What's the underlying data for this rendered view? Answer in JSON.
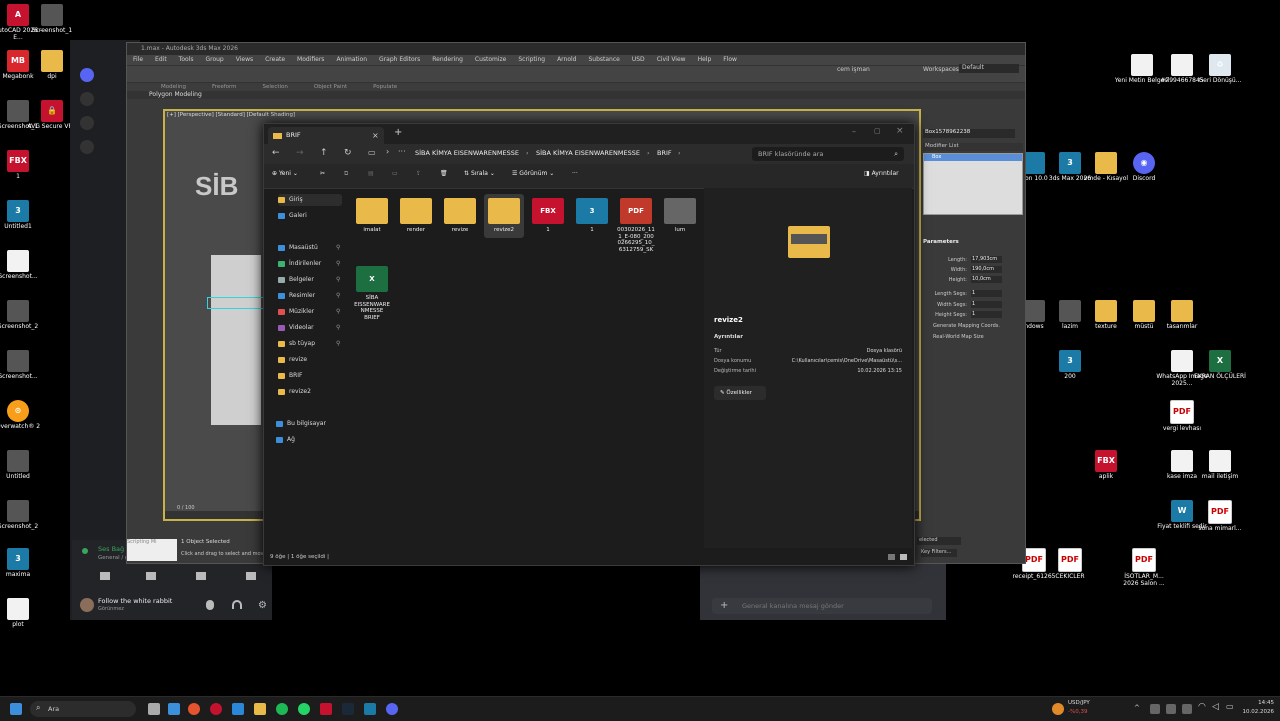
{
  "desktop_left": [
    {
      "label": "AutoCAD 2026 - E...",
      "icon": "A",
      "kind": "autocad"
    },
    {
      "label": "Screenshot_1",
      "icon": "",
      "kind": "gray"
    },
    {
      "label": "Megabonk",
      "icon": "MB",
      "kind": "mega"
    },
    {
      "label": "dpi",
      "icon": "",
      "kind": "folder"
    },
    {
      "label": "Screenshot_1",
      "icon": "",
      "kind": "gray"
    },
    {
      "label": "AVG Secure VPN",
      "icon": "🔒",
      "kind": "autocad"
    },
    {
      "label": "1",
      "icon": "FBX",
      "kind": "fbx"
    },
    {
      "label": "Untitled1",
      "icon": "3",
      "kind": "max"
    },
    {
      "label": "Screenshot...",
      "icon": "",
      "kind": "doc"
    },
    {
      "label": "Screenshot_2",
      "icon": "",
      "kind": "gray"
    },
    {
      "label": "Screenshot...",
      "icon": "",
      "kind": "gray"
    },
    {
      "label": "Overwatch® 2",
      "icon": "⊙",
      "kind": "ow"
    },
    {
      "label": "Untitled",
      "icon": "",
      "kind": "gray"
    },
    {
      "label": "Screenshot_2",
      "icon": "",
      "kind": "gray"
    },
    {
      "label": "maxima",
      "icon": "3",
      "kind": "max"
    },
    {
      "label": "plot",
      "icon": "",
      "kind": "doc"
    }
  ],
  "desktop_right": [
    {
      "label": "Yeni Metin Belgesi",
      "icon": "",
      "kind": "doc"
    },
    {
      "label": "#7994667845",
      "icon": "",
      "kind": "doc"
    },
    {
      "label": "Geri Dönüşü...",
      "icon": "♻",
      "kind": "recycle"
    },
    {
      "label": "sion 10.0",
      "icon": "",
      "kind": "max"
    },
    {
      "label": "3ds Max 2026",
      "icon": "3",
      "kind": "max"
    },
    {
      "label": "vmde - Kısayol",
      "icon": "",
      "kind": "folder"
    },
    {
      "label": "Discord",
      "icon": "◉",
      "kind": "discord"
    },
    {
      "label": "ndows",
      "icon": "",
      "kind": "gray"
    },
    {
      "label": "lazim",
      "icon": "",
      "kind": "gray"
    },
    {
      "label": "texture",
      "icon": "",
      "kind": "folder"
    },
    {
      "label": "müstü",
      "icon": "",
      "kind": "folder"
    },
    {
      "label": "tasarımlar",
      "icon": "",
      "kind": "folder"
    },
    {
      "label": "200",
      "icon": "3",
      "kind": "max"
    },
    {
      "label": "WhatsApp Image 2025...",
      "icon": "",
      "kind": "doc"
    },
    {
      "label": "EKRAN ÖLÇÜLERİ",
      "icon": "X",
      "kind": "xl"
    },
    {
      "label": "vergi levhası",
      "icon": "PDF",
      "kind": "pdf"
    },
    {
      "label": "aplik",
      "icon": "FBX",
      "kind": "fbx"
    },
    {
      "label": "kase imza",
      "icon": "",
      "kind": "doc"
    },
    {
      "label": "mail iletişim",
      "icon": "",
      "kind": "doc"
    },
    {
      "label": "Fiyat teklifi sedir",
      "icon": "W",
      "kind": "max"
    },
    {
      "label": "sona mimarl...",
      "icon": "PDF",
      "kind": "pdf"
    },
    {
      "label": "receipt_61265",
      "icon": "PDF",
      "kind": "pdf"
    },
    {
      "label": "CEKICLER",
      "icon": "PDF",
      "kind": "pdf"
    },
    {
      "label": "İSOTLAR_M... 2026 Salon ...",
      "icon": "PDF",
      "kind": "pdf"
    }
  ],
  "max": {
    "title": "1.max - Autodesk 3ds Max 2026",
    "menus": [
      "File",
      "Edit",
      "Tools",
      "Group",
      "Views",
      "Create",
      "Modifiers",
      "Animation",
      "Graph Editors",
      "Rendering",
      "Customize",
      "Scripting",
      "Arnold",
      "Substance",
      "USD",
      "Civil View",
      "Help",
      "Flow"
    ],
    "user": "cem işman",
    "workspace_label": "Workspaces:",
    "workspace": "Default",
    "ribbon": [
      "Modeling",
      "Freeform",
      "Selection",
      "Object Paint",
      "Populate"
    ],
    "subribbon": "Polygon Modeling",
    "viewport_label": "[+] [Perspective] [Standard] [Default Shading]",
    "object_name": "Box1578962238",
    "modifier_list": "Modifier List",
    "stack_item": "Box",
    "params_title": "Parameters",
    "params": [
      {
        "label": "Length:",
        "value": "17,903cm"
      },
      {
        "label": "Width:",
        "value": "190,0cm"
      },
      {
        "label": "Height:",
        "value": "10,0cm"
      },
      {
        "label": "Length Segs:",
        "value": "1"
      },
      {
        "label": "Width Segs:",
        "value": "1"
      },
      {
        "label": "Height Segs:",
        "value": "1"
      }
    ],
    "chk1": "Generate Mapping Coords.",
    "chk2": "Real-World Map Size",
    "status_sel": "1 Object Selected",
    "status_hint": "Click and drag to select and move",
    "scripting": "Scripting Mi",
    "timeline": "0 / 100",
    "selected_dd": "elected",
    "key_filters": "Key Filters..."
  },
  "discord": {
    "voice_title": "Ses Bağ",
    "voice_sub": "General / ge...",
    "user": "Follow the white rabbit",
    "user_status": "Görünmez",
    "chat_placeholder": "General kanalına mesaj gönder"
  },
  "explorer": {
    "tab": "BRIF",
    "crumbs": [
      "SİBA KİMYA EISENWARENMESSE",
      "SİBA KİMYA EISENWARENMESSE",
      "BRIF"
    ],
    "search": "BRIF klasöründe ara",
    "cmd_new": "Yeni",
    "cmd_sort": "Sırala",
    "cmd_view": "Görünüm",
    "cmd_more": "···",
    "cmd_details": "Ayrıntılar",
    "nav": [
      {
        "label": "Giriş",
        "color": "#e9b94a",
        "pin": false
      },
      {
        "label": "Galeri",
        "color": "#3c8fdb",
        "pin": false
      },
      {
        "label": "Masaüstü",
        "color": "#3c8fdb",
        "pin": true
      },
      {
        "label": "İndirilenler",
        "color": "#3cb371",
        "pin": true
      },
      {
        "label": "Belgeler",
        "color": "#9aa",
        "pin": true
      },
      {
        "label": "Resimler",
        "color": "#3c8fdb",
        "pin": true
      },
      {
        "label": "Müzikler",
        "color": "#e05050",
        "pin": true
      },
      {
        "label": "Videolar",
        "color": "#9b59b6",
        "pin": true
      },
      {
        "label": "sb tüyap",
        "color": "#e9b94a",
        "pin": true
      },
      {
        "label": "revize",
        "color": "#e9b94a",
        "pin": false
      },
      {
        "label": "BRIF",
        "color": "#e9b94a",
        "pin": false
      },
      {
        "label": "revize2",
        "color": "#e9b94a",
        "pin": false
      },
      {
        "label": "Bu bilgisayar",
        "color": "#3c8fdb",
        "pin": false
      },
      {
        "label": "Ağ",
        "color": "#3c8fdb",
        "pin": false
      }
    ],
    "files": [
      {
        "name": "imalat",
        "icon": "",
        "kind": "fold"
      },
      {
        "name": "render",
        "icon": "",
        "kind": "fold"
      },
      {
        "name": "revize",
        "icon": "",
        "kind": "fold"
      },
      {
        "name": "revize2",
        "icon": "",
        "kind": "fold"
      },
      {
        "name": "1",
        "icon": "FBX",
        "kind": "fbxi"
      },
      {
        "name": "1",
        "icon": "3",
        "kind": "maxi"
      },
      {
        "name": "00302026_11 1_E-080_200 0266295_10_ 6312759_SK",
        "icon": "PDF",
        "kind": "pdfi"
      },
      {
        "name": "lum",
        "icon": "",
        "kind": "img"
      },
      {
        "name": "SİBA EISSENWARE NMESSE BRIEF",
        "icon": "X",
        "kind": "xli"
      }
    ],
    "preview": {
      "name": "revize2",
      "section": "Ayrıntılar",
      "rows": [
        {
          "k": "Tür",
          "v": "Dosya klasörü"
        },
        {
          "k": "Dosya konumu",
          "v": "C:\\Kullanıcılar\\cemis\\OneDrive\\Masaüstü\\s..."
        },
        {
          "k": "Değiştirme tarihi",
          "v": "10.02.2026 13:15"
        }
      ],
      "props": "Özellikler"
    },
    "status": "9 öğe   |  1 öğe seçildi  |"
  },
  "taskbar": {
    "search": "Ara",
    "ticker_name": "USD/JPY",
    "ticker_value": "-%0,39",
    "time": "14:45",
    "date": "10.02.2026"
  }
}
